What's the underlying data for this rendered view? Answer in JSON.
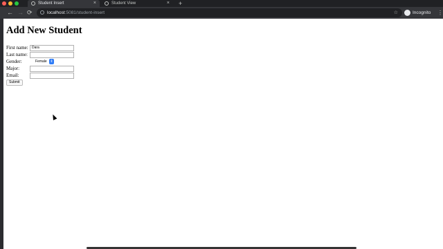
{
  "browser": {
    "tabs": [
      {
        "title": "Student Insert",
        "active": true
      },
      {
        "title": "Student View",
        "active": false
      }
    ],
    "new_tab_label": "+",
    "close_label": "×",
    "url_host": "localhost",
    "url_rest": ":5081/student-insert",
    "incognito_label": "Incognito",
    "nav": {
      "back": "←",
      "forward": "→",
      "reload": "⟳",
      "star": "☆",
      "menu": "⋮"
    }
  },
  "page": {
    "title": "Add New Student",
    "form": {
      "first_name_label": "First name:",
      "first_name_value": "Dara",
      "last_name_label": "Last name:",
      "last_name_value": "",
      "gender_label": "Gender:",
      "gender_value": "Female",
      "major_label": "Major:",
      "major_value": "",
      "email_label": "Email:",
      "email_value": "",
      "submit_label": "Submit"
    }
  },
  "colors": {
    "accent": "#2f7cf6",
    "chrome_dark": "#202124",
    "chrome_mid": "#35363a"
  }
}
